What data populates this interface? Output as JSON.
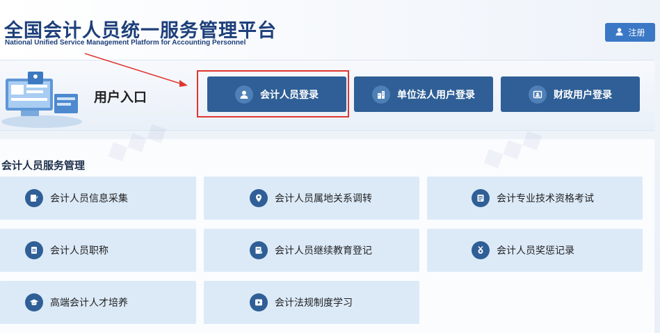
{
  "header": {
    "title": "全国会计人员统一服务管理平台",
    "subtitle": "National Unified Service Management Platform for Accounting Personnel",
    "register_label": "注册"
  },
  "entry": {
    "label": "用户入口",
    "buttons": [
      {
        "label": "会计人员登录",
        "icon": "user-icon"
      },
      {
        "label": "单位法人用户登录",
        "icon": "building-icon"
      },
      {
        "label": "财政用户登录",
        "icon": "id-card-icon"
      }
    ]
  },
  "services": {
    "title": "会计人员服务管理",
    "cards": [
      {
        "label": "会计人员信息采集",
        "icon": "edit-icon"
      },
      {
        "label": "会计人员属地关系调转",
        "icon": "location-icon"
      },
      {
        "label": "会计专业技术资格考试",
        "icon": "exam-icon"
      },
      {
        "label": "会计人员职称",
        "icon": "document-icon"
      },
      {
        "label": "会计人员继续教育登记",
        "icon": "register-icon"
      },
      {
        "label": "会计人员奖惩记录",
        "icon": "medal-icon"
      },
      {
        "label": "高端会计人才培养",
        "icon": "graduation-cap-icon"
      },
      {
        "label": "会计法规制度学习",
        "icon": "play-icon"
      }
    ]
  },
  "colors": {
    "brand": "#1d3f7a",
    "button": "#2f5f96",
    "card": "#dceaf8",
    "highlight": "#e0352f"
  }
}
